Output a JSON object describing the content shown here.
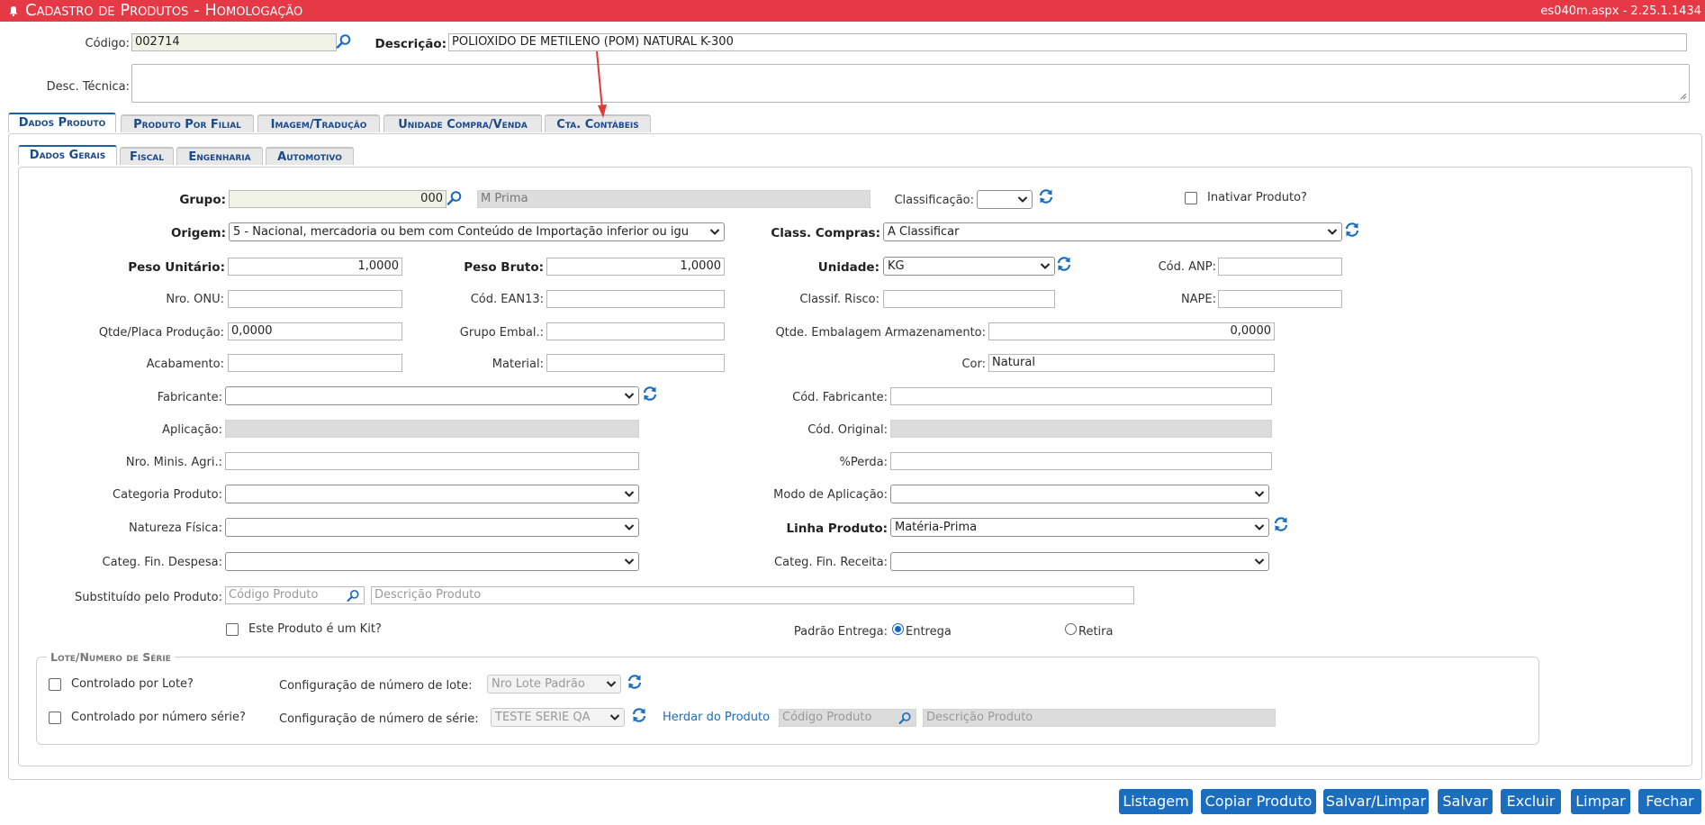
{
  "header": {
    "title": "Cadastro de Produtos - Homologação",
    "version": "es040m.aspx - 2.25.1.1434"
  },
  "top": {
    "codigo_label": "Código:",
    "codigo_value": "002714",
    "descricao_label": "Descrição:",
    "descricao_value": "POLIOXIDO DE METILENO (POM) NATURAL K-300",
    "desc_tecnica_label": "Desc. Técnica:"
  },
  "main_tabs": [
    "Dados Produto",
    "Produto Por Filial",
    "Imagem/Tradução",
    "Unidade Compra/Venda",
    "Cta. Contábeis"
  ],
  "sub_tabs": [
    "Dados Gerais",
    "Fiscal",
    "Engenharia",
    "Automotivo"
  ],
  "form": {
    "grupo_label": "Grupo:",
    "grupo_value": "000",
    "grupo_desc": "M Prima",
    "classificacao_label": "Classificação:",
    "inativar_label": "Inativar Produto?",
    "origem_label": "Origem:",
    "origem_value": "5 - Nacional, mercadoria ou bem com Conteúdo de Importação inferior ou igu",
    "class_compras_label": "Class. Compras:",
    "class_compras_value": "A Classificar",
    "peso_unitario_label": "Peso Unitário:",
    "peso_unitario_value": "1,0000",
    "peso_bruto_label": "Peso Bruto:",
    "peso_bruto_value": "1,0000",
    "unidade_label": "Unidade:",
    "unidade_value": "KG",
    "cod_anp_label": "Cód. ANP:",
    "nro_onu_label": "Nro. ONU:",
    "cod_ean_label": "Cód. EAN13:",
    "classif_risco_label": "Classif. Risco:",
    "nape_label": "NAPE:",
    "qtde_placa_label": "Qtde/Placa Produção:",
    "qtde_placa_value": "0,0000",
    "grupo_embal_label": "Grupo Embal.:",
    "qtde_embalagem_label": "Qtde. Embalagem Armazenamento:",
    "qtde_embalagem_value": "0,0000",
    "acabamento_label": "Acabamento:",
    "material_label": "Material:",
    "cor_label": "Cor:",
    "cor_value": "Natural",
    "fabricante_label": "Fabricante:",
    "cod_fabricante_label": "Cód. Fabricante:",
    "aplicacao_label": "Aplicação:",
    "cod_original_label": "Cód. Original:",
    "nro_minis_label": "Nro. Minis. Agri.:",
    "perda_label": "%Perda:",
    "categoria_produto_label": "Categoria Produto:",
    "modo_aplicacao_label": "Modo de Aplicação:",
    "natureza_fisica_label": "Natureza Física:",
    "linha_produto_label": "Linha Produto:",
    "linha_produto_value": "Matéria-Prima",
    "categ_despesa_label": "Categ. Fin. Despesa:",
    "categ_receita_label": "Categ. Fin. Receita:",
    "substituido_label": "Substituído pelo Produto:",
    "codigo_produto_placeholder": "Código Produto",
    "descricao_produto_placeholder": "Descrição Produto",
    "kit_label": "Este Produto é um Kit?",
    "padrao_entrega_label": "Padrão Entrega:",
    "entrega_label": "Entrega",
    "retira_label": "Retira"
  },
  "lote": {
    "legend": "Lote/Numero de Série",
    "controlado_lote_label": "Controlado por Lote?",
    "controlado_serie_label": "Controlado por número série?",
    "config_lote_label": "Configuração de número de lote:",
    "config_lote_value": "Nro Lote Padrão",
    "config_serie_label": "Configuração de número de série:",
    "config_serie_value": "TESTE SERIE QA",
    "herdar_label": "Herdar do Produto",
    "codigo_placeholder": "Código Produto",
    "descricao_placeholder": "Descrição Produto"
  },
  "buttons": [
    "Listagem",
    "Copiar Produto",
    "Salvar/Limpar",
    "Salvar",
    "Excluir",
    "Limpar",
    "Fechar"
  ],
  "colors": {
    "header": "#e63946",
    "accent": "#1a6dbf",
    "annotation_arrow": "#e53935"
  }
}
